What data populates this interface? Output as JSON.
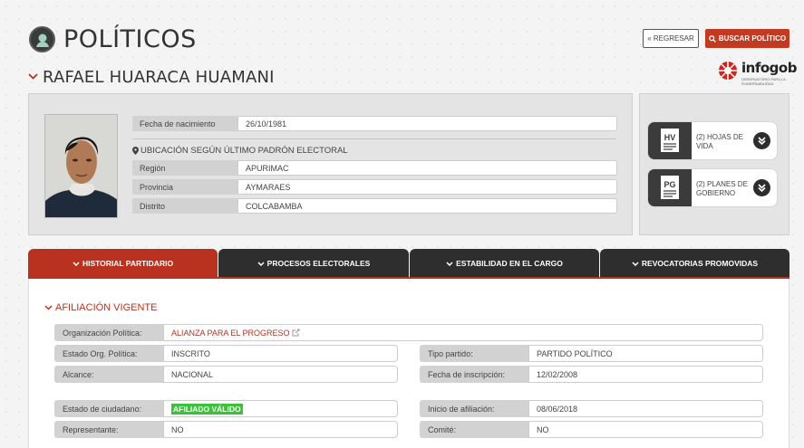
{
  "header": {
    "title": "POLÍTICOS",
    "back_label": "« REGRESAR",
    "search_label": "BUSCAR POLÍTICO",
    "brand_name": "infogob",
    "brand_tagline": "OBSERVATORIO PARA LA GOBERNABILIDAD"
  },
  "person": {
    "name": "RAFAEL HUARACA HUAMANI",
    "birth": {
      "label": "Fecha de nacimiento",
      "value": "26/10/1981"
    },
    "location_heading": "UBICACIÓN SEGÚN ÚLTIMO PADRÓN ELECTORAL",
    "region": {
      "label": "Región",
      "value": "APURIMAC"
    },
    "province": {
      "label": "Provincia",
      "value": "AYMARAES"
    },
    "district": {
      "label": "Distrito",
      "value": "COLCABAMBA"
    }
  },
  "docs": [
    {
      "code": "HV",
      "label": "(2) HOJAS DE VIDA"
    },
    {
      "code": "PG",
      "label": "(2) PLANES DE GOBIERNO"
    }
  ],
  "tabs": [
    {
      "label": "HISTORIAL PARTIDARIO",
      "active": true
    },
    {
      "label": "PROCESOS ELECTORALES",
      "active": false
    },
    {
      "label": "ESTABILIDAD EN EL CARGO",
      "active": false
    },
    {
      "label": "REVOCATORIAS PROMOVIDAS",
      "active": false
    }
  ],
  "affiliation": {
    "title": "AFILIACIÓN VIGENTE",
    "org": {
      "label": "Organización Política:",
      "value": "ALIANZA PARA EL PROGRESO"
    },
    "state_org": {
      "label": "Estado Org. Política:",
      "value": "INSCRITO"
    },
    "party_type": {
      "label": "Tipo partido:",
      "value": "PARTIDO POLÍTICO"
    },
    "scope": {
      "label": "Alcance:",
      "value": "NACIONAL"
    },
    "reg_date": {
      "label": "Fecha de inscripción:",
      "value": "12/02/2008"
    },
    "citizen_state": {
      "label": "Estado de ciudadano:",
      "value": "AFILIADO VÁLIDO"
    },
    "aff_start": {
      "label": "Inicio de afiliación:",
      "value": "08/06/2018"
    },
    "representative": {
      "label": "Representante:",
      "value": "NO"
    },
    "committee": {
      "label": "Comité:",
      "value": "NO"
    }
  },
  "colors": {
    "accent": "#b8321f",
    "dark": "#2e2e2e",
    "valid": "#3cc23a"
  }
}
